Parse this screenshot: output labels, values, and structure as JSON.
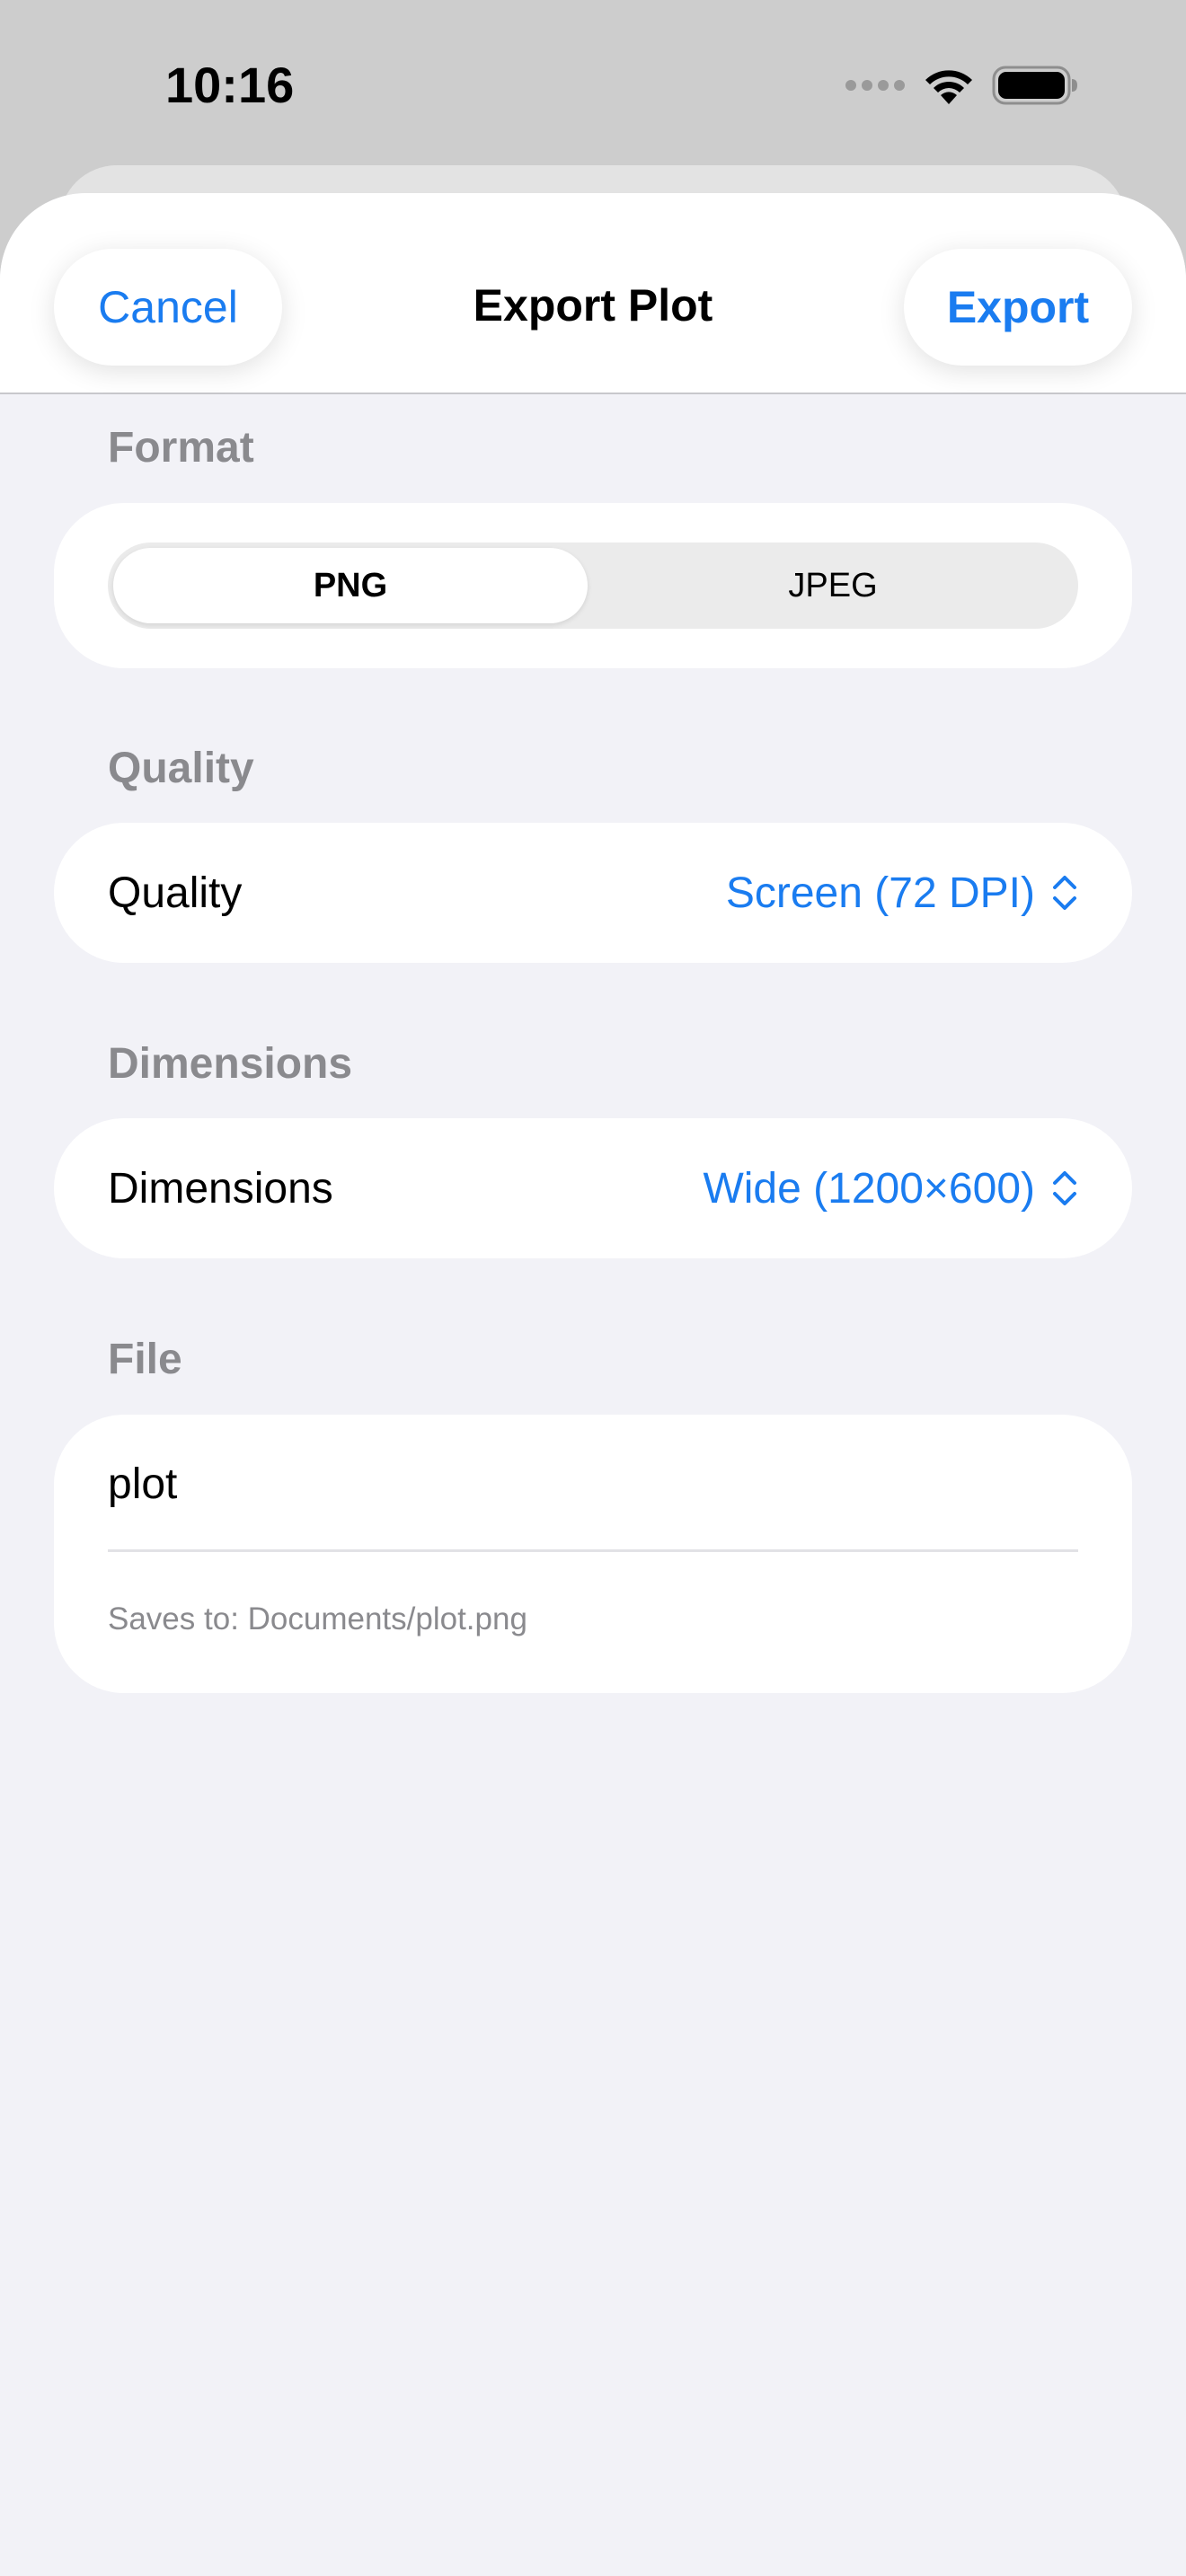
{
  "status_bar": {
    "time": "10:16",
    "icons": [
      "signal-dots-icon",
      "wifi-icon",
      "battery-icon"
    ]
  },
  "header": {
    "cancel_label": "Cancel",
    "title": "Export Plot",
    "export_label": "Export"
  },
  "format": {
    "section_label": "Format",
    "options": [
      "PNG",
      "JPEG"
    ],
    "selected": "PNG"
  },
  "quality": {
    "section_label": "Quality",
    "row_label": "Quality",
    "value": "Screen (72 DPI)"
  },
  "dimensions": {
    "section_label": "Dimensions",
    "row_label": "Dimensions",
    "value": "Wide (1200×600)"
  },
  "file": {
    "section_label": "File",
    "filename": "plot",
    "save_path": "Saves to: Documents/plot.png"
  },
  "colors": {
    "accent": "#1a7cf0",
    "sheet_background": "#f2f2f7",
    "secondary_text": "#8a8a8e"
  }
}
